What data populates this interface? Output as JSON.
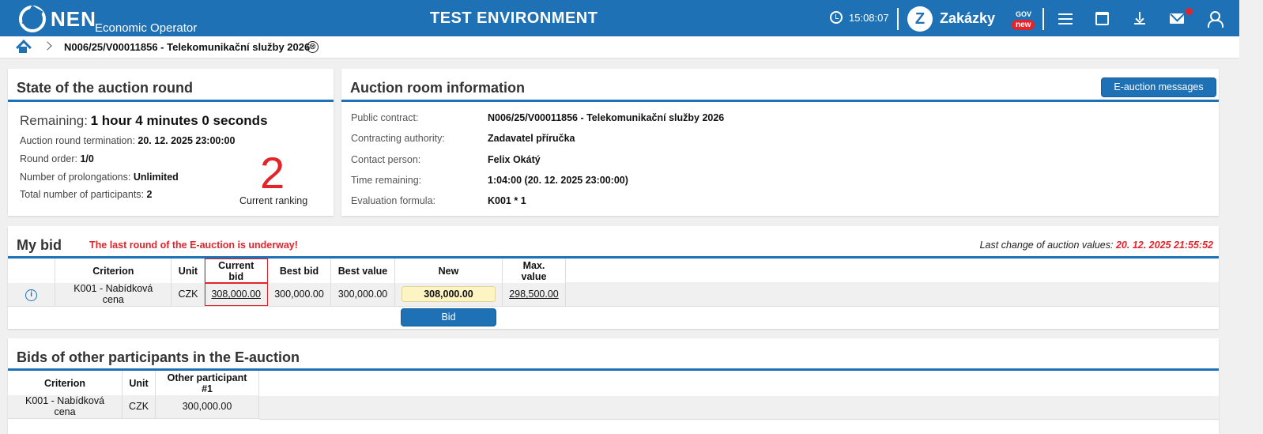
{
  "header": {
    "logo_text": "NEN",
    "logo_subtext": "Economic Operator",
    "environment": "TEST ENVIRONMENT",
    "clock": "15:08:07",
    "zakazky": "Zakázky",
    "zakazky_sup": "GOV",
    "zakazky_badge": "new"
  },
  "breadcrumb": {
    "current": "N006/25/V00011856 - Telekomunikační služby 2026",
    "close": "⊗"
  },
  "round_state": {
    "title": "State of the auction round",
    "remaining_label": "Remaining:",
    "remaining_value": "1 hour 4 minutes 0 seconds",
    "termination_label": "Auction round termination:",
    "termination_value": "20. 12. 2025 23:00:00",
    "order_label": "Round order:",
    "order_value": "1/0",
    "prolong_label": "Number of prolongations:",
    "prolong_value": "Unlimited",
    "participants_label": "Total number of participants:",
    "participants_value": "2",
    "ranking_value": "2",
    "ranking_label": "Current ranking"
  },
  "room_info": {
    "title": "Auction room information",
    "messages_button": "E-auction messages",
    "rows": [
      {
        "label": "Public contract:",
        "value": "N006/25/V00011856 - Telekomunikační služby 2026"
      },
      {
        "label": "Contracting authority:",
        "value": "Zadavatel příručka"
      },
      {
        "label": "Contact person:",
        "value": "Felix Okátý"
      },
      {
        "label": "Time remaining:",
        "value": "1:04:00 (20. 12. 2025 23:00:00)"
      },
      {
        "label": "Evaluation formula:",
        "value": "K001 * 1"
      }
    ]
  },
  "my_bid": {
    "title": "My bid",
    "warning": "The last round of the E-auction is underway!",
    "last_change_label": "Last change of auction values:",
    "last_change_value": "20. 12. 2025 21:55:52",
    "columns": [
      "Criterion",
      "Unit",
      "Current bid",
      "Best bid",
      "Best value",
      "New",
      "Max. value"
    ],
    "row": {
      "criterion": "K001 - Nabídková cena",
      "unit": "CZK",
      "current_bid": "308,000.00",
      "best_bid": "300,000.00",
      "best_value": "300,000.00",
      "new": "308,000.00",
      "max_value": "298,500.00"
    },
    "bid_button": "Bid"
  },
  "others": {
    "title": "Bids of other participants in the E-auction",
    "columns": [
      "Criterion",
      "Unit",
      "Other participant #1"
    ],
    "row": {
      "criterion": "K001 - Nabídková cena",
      "unit": "CZK",
      "value": "300,000.00"
    }
  },
  "colors": {
    "primary": "#1f71b5",
    "alert": "#e4242b",
    "input_bg": "#fdf4c4"
  }
}
